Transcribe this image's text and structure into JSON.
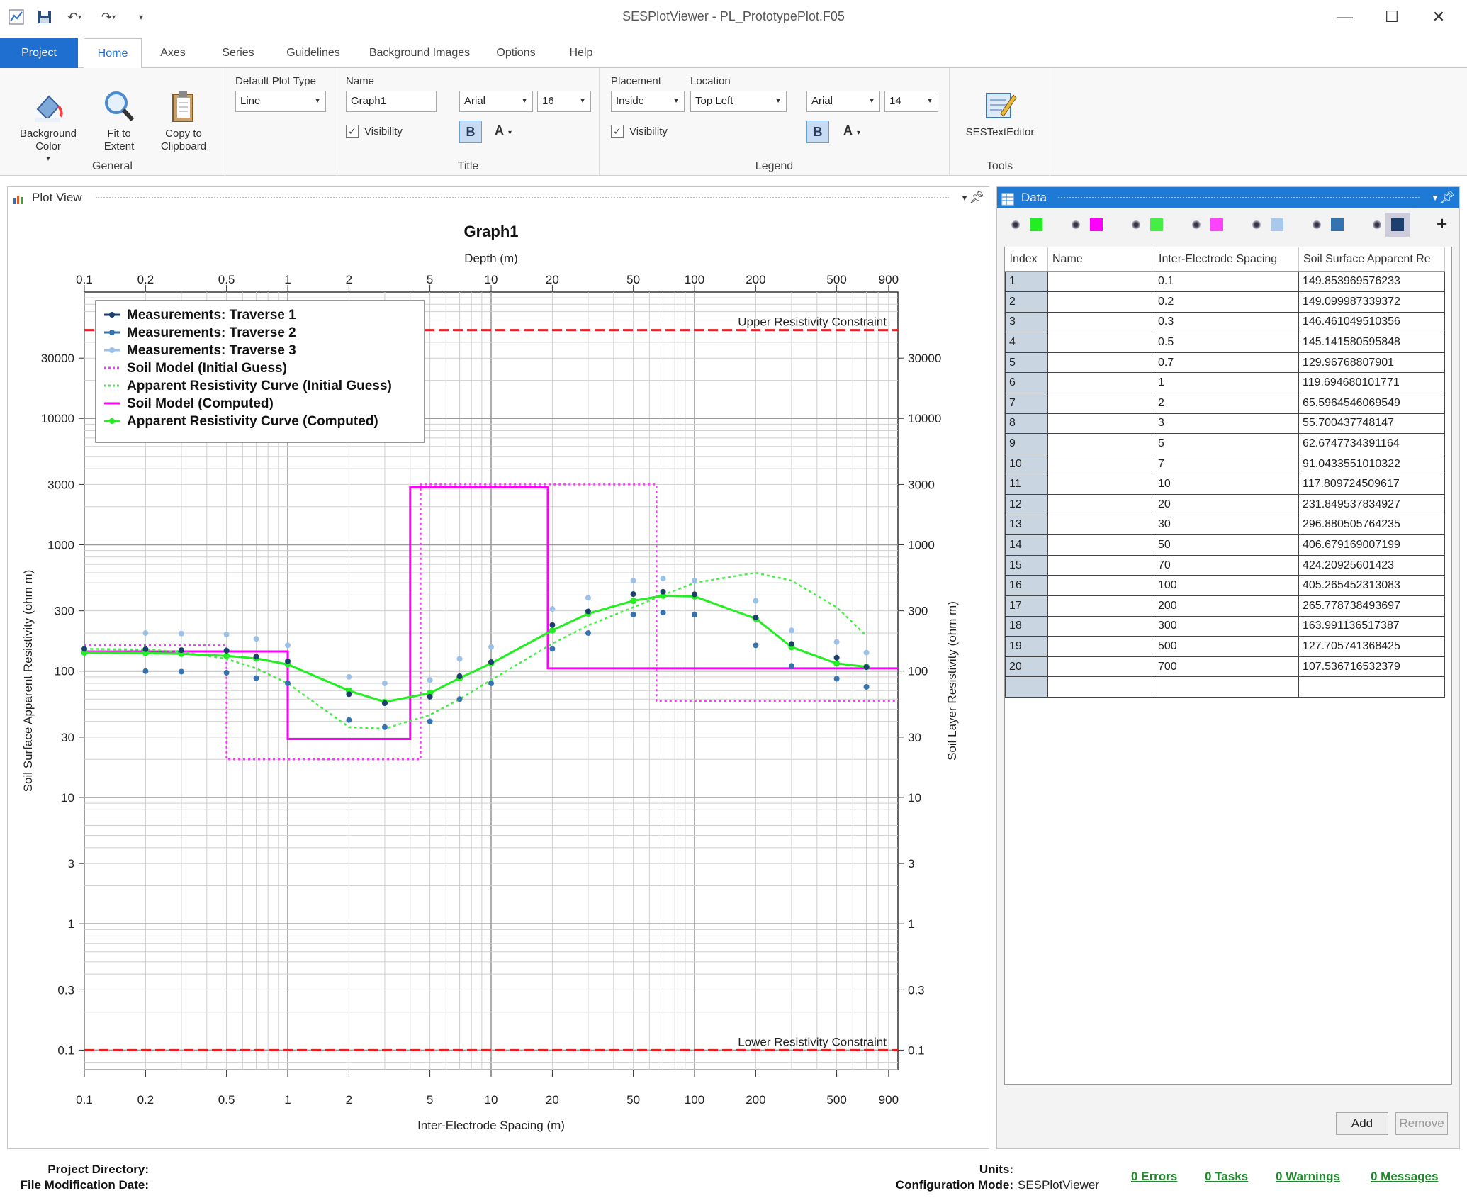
{
  "app": {
    "title": "SESPlotViewer - PL_PrototypePlot.F05"
  },
  "quick_access": [
    "app-icon",
    "save-icon",
    "undo-icon",
    "redo-icon",
    "customize-icon"
  ],
  "window_controls": [
    "minimize",
    "maximize",
    "close"
  ],
  "tabs": [
    {
      "label": "Project"
    },
    {
      "label": "Home"
    },
    {
      "label": "Axes"
    },
    {
      "label": "Series"
    },
    {
      "label": "Guidelines"
    },
    {
      "label": "Background Images"
    },
    {
      "label": "Options"
    },
    {
      "label": "Help"
    }
  ],
  "ribbon": {
    "general": {
      "label": "General",
      "background_color": "Background Color",
      "fit_to_extent": "Fit to Extent",
      "copy_to_clipboard": "Copy to Clipboard",
      "default_plot_type_label": "Default Plot Type",
      "default_plot_type": "Line"
    },
    "title": {
      "label": "Title",
      "name_label": "Name",
      "name_value": "Graph1",
      "visibility": "Visibility",
      "font": "Arial",
      "size": "16",
      "bold": "B",
      "color": "A"
    },
    "legend": {
      "label": "Legend",
      "placement_label": "Placement",
      "placement": "Inside",
      "location_label": "Location",
      "location": "Top Left",
      "visibility": "Visibility",
      "font": "Arial",
      "size": "14",
      "bold": "B",
      "color": "A"
    },
    "tools": {
      "label": "Tools",
      "editor": "SESTextEditor"
    }
  },
  "plot_view": {
    "title": "Plot View"
  },
  "chart_data": {
    "type": "line",
    "title": "Graph1",
    "xlabel": "Inter-Electrode Spacing (m)",
    "x2label": "Depth (m)",
    "ylabel": "Soil Surface Apparent Resistivity (ohm m)",
    "y2label": "Soil Layer Resistivity (ohm m)",
    "xscale": "log",
    "yscale": "log",
    "xlim": [
      0.1,
      1000
    ],
    "ylim": [
      0.07,
      100000
    ],
    "xticks": [
      "0.1",
      "0.2",
      "0.5",
      "1",
      "2",
      "5",
      "10",
      "20",
      "50",
      "100",
      "200",
      "500",
      "900"
    ],
    "yticks": [
      "0.1",
      "0.3",
      "1",
      "3",
      "10",
      "30",
      "100",
      "300",
      "1000",
      "3000",
      "10000",
      "30000"
    ],
    "grid": true,
    "legend_position": "top-left",
    "colors": {
      "traverse1": "#1c3f6e",
      "traverse2": "#3572b0",
      "traverse3": "#9dc1e6",
      "initial_model": "#ff33ff",
      "initial_curve": "#44ee44",
      "computed_model": "#ff00ff",
      "computed_curve": "#22ee22",
      "constraint": "#ee1c24"
    },
    "series": [
      {
        "name": "Measurements: Traverse 1",
        "style": "points",
        "x": [
          0.1,
          0.2,
          0.3,
          0.5,
          0.7,
          1,
          2,
          3,
          5,
          7,
          10,
          20,
          30,
          50,
          70,
          100,
          200,
          300,
          500,
          700
        ],
        "y": [
          149.9,
          149.1,
          146.5,
          145.1,
          130.0,
          119.7,
          65.6,
          55.7,
          62.7,
          91.0,
          117.8,
          231.8,
          296.9,
          406.7,
          424.2,
          405.3,
          265.8,
          164.0,
          127.7,
          107.5
        ]
      },
      {
        "name": "Measurements: Traverse 2",
        "style": "points",
        "x": [
          0.2,
          0.3,
          0.5,
          0.7,
          1,
          2,
          3,
          5,
          7,
          10,
          20,
          30,
          50,
          70,
          100,
          200,
          300,
          500,
          700
        ],
        "y": [
          100,
          99,
          97,
          88,
          80,
          41,
          36,
          40,
          60,
          80,
          150,
          200,
          280,
          290,
          280,
          160,
          110,
          87,
          75
        ]
      },
      {
        "name": "Measurements: Traverse 3",
        "style": "points",
        "x": [
          0.2,
          0.3,
          0.5,
          0.7,
          1,
          2,
          3,
          5,
          7,
          10,
          20,
          30,
          50,
          70,
          100,
          200,
          300,
          500,
          700
        ],
        "y": [
          200,
          198,
          195,
          180,
          160,
          90,
          80,
          85,
          125,
          155,
          310,
          380,
          520,
          540,
          520,
          360,
          210,
          170,
          140
        ]
      },
      {
        "name": "Soil Model (Initial Guess)",
        "style": "dotted-step",
        "x": [
          0.1,
          0.5,
          0.5,
          4.5,
          4.5,
          65,
          65,
          1000
        ],
        "y": [
          160,
          160,
          20,
          20,
          3000,
          3000,
          58,
          58
        ]
      },
      {
        "name": "Apparent Resistivity Curve (Initial Guess)",
        "style": "dotted-line",
        "x": [
          0.1,
          0.2,
          0.3,
          0.5,
          0.7,
          1,
          2,
          3,
          5,
          7,
          10,
          20,
          30,
          50,
          70,
          100,
          200,
          300,
          500,
          700
        ],
        "y": [
          150,
          148,
          142,
          125,
          105,
          80,
          36,
          35,
          45,
          60,
          85,
          165,
          230,
          320,
          400,
          500,
          600,
          520,
          320,
          190
        ]
      },
      {
        "name": "Soil Model (Computed)",
        "style": "step",
        "x": [
          0.1,
          1,
          1,
          4,
          4,
          19,
          19,
          1000
        ],
        "y": [
          143,
          143,
          29,
          29,
          2850,
          2850,
          105,
          105
        ]
      },
      {
        "name": "Apparent Resistivity Curve (Computed)",
        "style": "line-markers",
        "x": [
          0.1,
          0.2,
          0.3,
          0.5,
          0.7,
          1,
          2,
          3,
          5,
          7,
          10,
          20,
          30,
          50,
          70,
          100,
          200,
          300,
          500,
          700
        ],
        "y": [
          140,
          139,
          137,
          132,
          126,
          113,
          70,
          57,
          67,
          88,
          115,
          210,
          285,
          360,
          395,
          390,
          260,
          155,
          115,
          108
        ]
      }
    ],
    "guidelines": [
      {
        "label": "Upper Resistivity Constraint",
        "y": 50000
      },
      {
        "label": "Lower Resistivity Constraint",
        "y": 0.1
      }
    ]
  },
  "data_panel": {
    "title": "Data",
    "swatch_colors": [
      "#22ee22",
      "#ff00ff",
      "#44ee44",
      "#ff44ff",
      "#a8c8ec",
      "#3572b0",
      "#1c3f6e"
    ],
    "add_series": "+",
    "columns": [
      "Index",
      "Name",
      "Inter-Electrode Spacing",
      "Soil Surface Apparent Re"
    ],
    "rows": [
      [
        "1",
        "",
        "0.1",
        "149.853969576233"
      ],
      [
        "2",
        "",
        "0.2",
        "149.099987339372"
      ],
      [
        "3",
        "",
        "0.3",
        "146.461049510356"
      ],
      [
        "4",
        "",
        "0.5",
        "145.141580595848"
      ],
      [
        "5",
        "",
        "0.7",
        "129.96768807901"
      ],
      [
        "6",
        "",
        "1",
        "119.694680101771"
      ],
      [
        "7",
        "",
        "2",
        "65.5964546069549"
      ],
      [
        "8",
        "",
        "3",
        "55.700437748147"
      ],
      [
        "9",
        "",
        "5",
        "62.6747734391164"
      ],
      [
        "10",
        "",
        "7",
        "91.0433551010322"
      ],
      [
        "11",
        "",
        "10",
        "117.809724509617"
      ],
      [
        "12",
        "",
        "20",
        "231.849537834927"
      ],
      [
        "13",
        "",
        "30",
        "296.880505764235"
      ],
      [
        "14",
        "",
        "50",
        "406.679169007199"
      ],
      [
        "15",
        "",
        "70",
        "424.20925601423"
      ],
      [
        "16",
        "",
        "100",
        "405.265452313083"
      ],
      [
        "17",
        "",
        "200",
        "265.778738493697"
      ],
      [
        "18",
        "",
        "300",
        "163.991136517387"
      ],
      [
        "19",
        "",
        "500",
        "127.705741368425"
      ],
      [
        "20",
        "",
        "700",
        "107.536716532379"
      ],
      [
        "",
        "",
        "",
        ""
      ]
    ],
    "add": "Add",
    "remove": "Remove"
  },
  "status": {
    "project_directory": "Project Directory:",
    "file_modification": "File Modification Date:",
    "units": "Units:",
    "config_mode_label": "Configuration Mode:",
    "config_mode": "SESPlotViewer",
    "errors": "0 Errors",
    "tasks": "0 Tasks",
    "warnings": "0 Warnings",
    "messages": "0 Messages"
  }
}
